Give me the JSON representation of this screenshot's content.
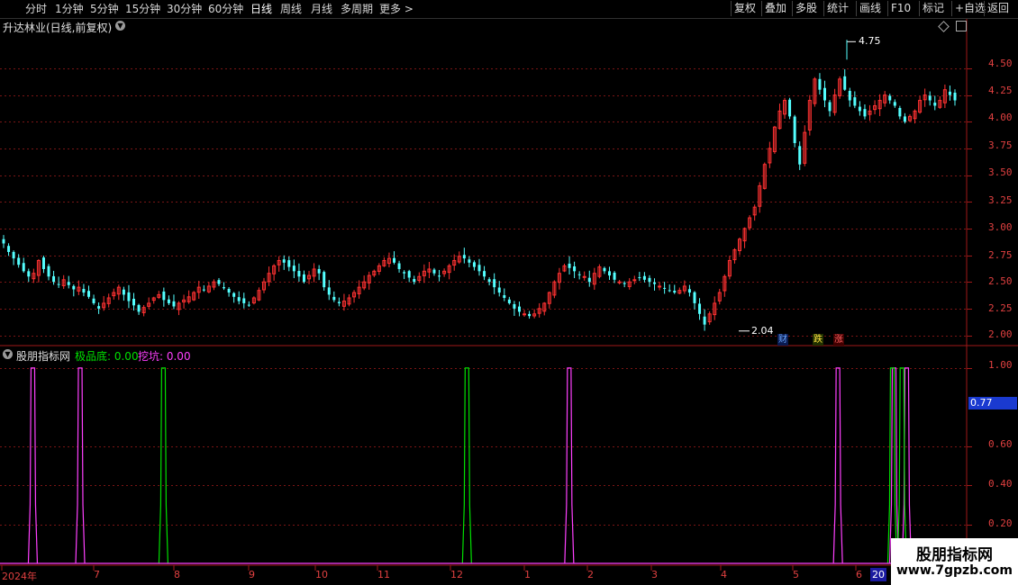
{
  "toolbar": {
    "periods": [
      "分时",
      "1分钟",
      "5分钟",
      "15分钟",
      "30分钟",
      "60分钟",
      "日线",
      "周线",
      "月线",
      "多周期",
      "更多 >"
    ],
    "active_period": "日线",
    "right": [
      "复权",
      "叠加",
      "多股",
      "统计",
      "画线",
      "F10",
      "标记",
      "+自选",
      "返回"
    ]
  },
  "main_chart": {
    "title": "升达林业(日线,前复权)",
    "y_ticks": [
      "4.50",
      "4.25",
      "4.00",
      "3.75",
      "3.50",
      "3.25",
      "3.00",
      "2.75",
      "2.50",
      "2.25",
      "2.00"
    ],
    "high_label": "4.75",
    "low_label": "2.04",
    "badges": [
      "财",
      "跌",
      "涨"
    ]
  },
  "sub_chart": {
    "title": "股朋指标网",
    "ind_a_label": "极品底: 0.00",
    "ind_b_label": "挖坑: 0.00",
    "y_ticks": [
      "1.00",
      "0.60",
      "0.40",
      "0.20"
    ],
    "current_value": "0.77"
  },
  "x_axis": {
    "labels": [
      "2024年",
      "7",
      "8",
      "9",
      "10",
      "11",
      "12",
      "1",
      "2",
      "3",
      "4",
      "5",
      "6"
    ],
    "cursor_label": "20"
  },
  "watermark": {
    "line1": "股朋指标网",
    "line2": "www.7gpzb.com"
  },
  "chart_data": {
    "type": "candlestick",
    "main_ylim": [
      1.92,
      4.82
    ],
    "sub_ylim": [
      0,
      1.05
    ],
    "prices": [
      2.86,
      2.78,
      2.72,
      2.66,
      2.6,
      2.55,
      2.58,
      2.7,
      2.62,
      2.55,
      2.5,
      2.48,
      2.52,
      2.47,
      2.43,
      2.45,
      2.4,
      2.36,
      2.3,
      2.25,
      2.3,
      2.35,
      2.4,
      2.45,
      2.38,
      2.32,
      2.28,
      2.22,
      2.26,
      2.3,
      2.35,
      2.38,
      2.33,
      2.3,
      2.27,
      2.3,
      2.33,
      2.36,
      2.4,
      2.45,
      2.42,
      2.46,
      2.5,
      2.48,
      2.44,
      2.4,
      2.36,
      2.32,
      2.3,
      2.28,
      2.35,
      2.42,
      2.5,
      2.58,
      2.65,
      2.7,
      2.68,
      2.64,
      2.6,
      2.55,
      2.5,
      2.56,
      2.62,
      2.58,
      2.45,
      2.38,
      2.33,
      2.3,
      2.32,
      2.35,
      2.4,
      2.45,
      2.5,
      2.56,
      2.6,
      2.65,
      2.7,
      2.72,
      2.68,
      2.62,
      2.58,
      2.54,
      2.5,
      2.55,
      2.6,
      2.62,
      2.58,
      2.55,
      2.6,
      2.65,
      2.7,
      2.74,
      2.72,
      2.68,
      2.64,
      2.6,
      2.55,
      2.5,
      2.45,
      2.4,
      2.35,
      2.3,
      2.25,
      2.22,
      2.2,
      2.18,
      2.2,
      2.25,
      2.3,
      2.4,
      2.5,
      2.58,
      2.65,
      2.63,
      2.6,
      2.57,
      2.55,
      2.5,
      2.58,
      2.64,
      2.6,
      2.56,
      2.52,
      2.5,
      2.48,
      2.5,
      2.52,
      2.54,
      2.52,
      2.5,
      2.48,
      2.46,
      2.44,
      2.42,
      2.4,
      2.42,
      2.46,
      2.4,
      2.3,
      2.2,
      2.1,
      2.2,
      2.3,
      2.4,
      2.55,
      2.7,
      2.8,
      2.9,
      3.0,
      3.1,
      3.2,
      3.4,
      3.6,
      3.75,
      3.95,
      4.1,
      4.2,
      4.05,
      3.8,
      3.6,
      3.9,
      4.2,
      4.4,
      4.3,
      4.2,
      4.1,
      4.25,
      4.4,
      4.3,
      4.2,
      4.15,
      4.1,
      4.05,
      4.1,
      4.15,
      4.2,
      4.25,
      4.2,
      4.15,
      4.05,
      4.0,
      4.05,
      4.1,
      4.2,
      4.25,
      4.2,
      4.15,
      4.2,
      4.3,
      4.25,
      4.2
    ],
    "ind_a_spikes": [
      0.17,
      0.484,
      0.924,
      0.934
    ],
    "ind_b_spikes": [
      0.0349,
      0.0839,
      0.5898,
      0.8678,
      0.9259,
      0.9389
    ]
  }
}
